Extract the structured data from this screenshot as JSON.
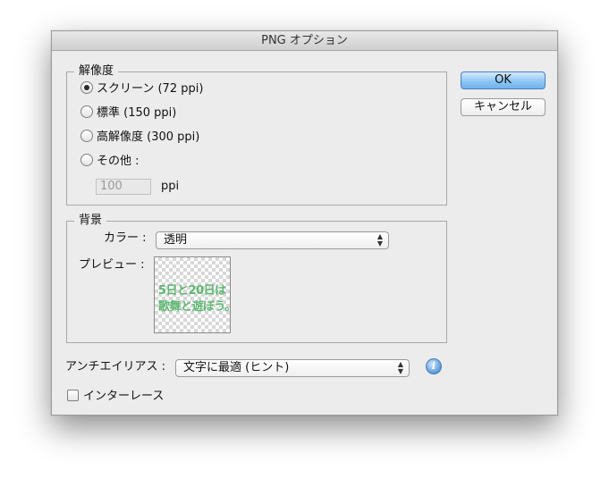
{
  "window": {
    "title": "PNG オプション"
  },
  "resolution": {
    "legend": "解像度",
    "options": [
      {
        "label": "スクリーン (72 ppi)",
        "selected": true
      },
      {
        "label": "標準 (150 ppi)",
        "selected": false
      },
      {
        "label": "高解像度 (300 ppi)",
        "selected": false
      },
      {
        "label": "その他 :",
        "selected": false
      }
    ],
    "custom_value": "100",
    "custom_unit": "ppi"
  },
  "background": {
    "legend": "背景",
    "color_label": "カラー :",
    "color_value": "透明",
    "preview_label": "プレビュー :",
    "preview_lines": [
      "5日と20日は",
      "歌舞と遊ぼう。"
    ]
  },
  "antialias": {
    "label": "アンチエイリアス :",
    "value": "文字に最適 (ヒント)"
  },
  "interlace": {
    "label": "インターレース",
    "checked": false
  },
  "buttons": {
    "ok": "OK",
    "cancel": "キャンセル"
  },
  "icons": {
    "info": "info-icon",
    "popup_arrows": "updown-arrows-icon"
  },
  "colors": {
    "ok_button": "#8ec6f3",
    "preview_text": "#5fb873"
  }
}
